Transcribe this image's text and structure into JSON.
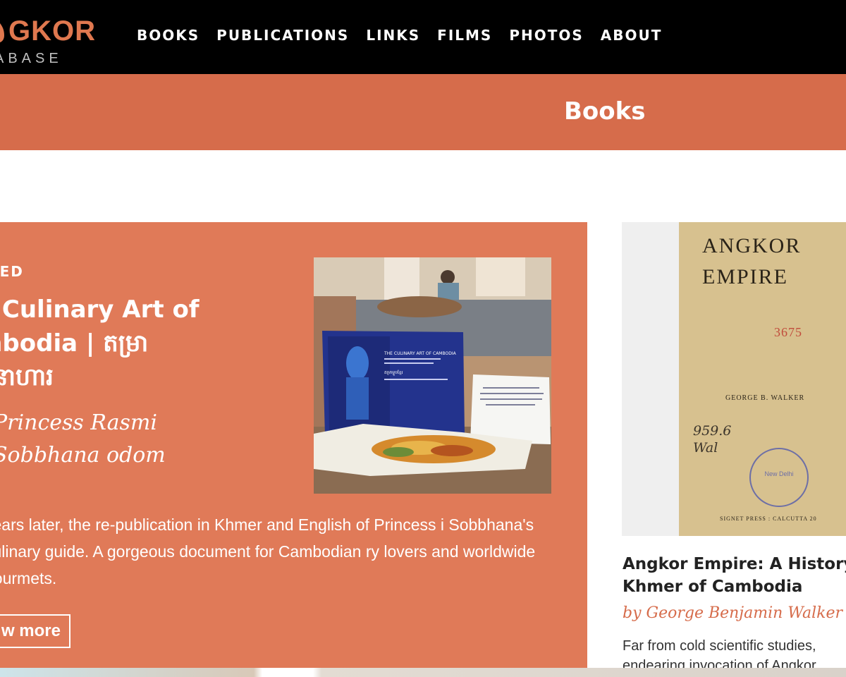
{
  "brand": {
    "logo_main": "GKOR",
    "logo_sub": "ABASE",
    "accent": "#d66c4b"
  },
  "nav": {
    "items": [
      "BOOKS",
      "PUBLICATIONS",
      "LINKS",
      "FILMS",
      "PHOTOS",
      "ABOUT"
    ]
  },
  "page": {
    "title": "Books"
  },
  "featured": {
    "kicker": "URED",
    "title": "e Culinary Art of mbodia | តម្រា ជនាហារ",
    "author": "Princess Rasmi Sobbhana odom",
    "description": "years later, the re-publication in Khmer and English of Princess i Sobbhana's culinary guide. A gorgeous document for Cambodian ry lovers and worldwide gourmets.",
    "button_label": "w more",
    "image": {
      "book_title": "THE CULINARY ART OF CAMBODIA",
      "book_khmer": "តម្រាម្ហូបខ្មែរ"
    }
  },
  "side_book": {
    "cover": {
      "title": "ANGKOR\nEMPIRE",
      "number": "3675",
      "author": "GEORGE B. WALKER",
      "shelfmark": "959.6\nWal",
      "stamp": "New Delhi",
      "publisher": "SIGNET PRESS : CALCUTTA 20"
    },
    "title_line1": "Angkor Empire: A History",
    "title_line2": "Khmer of Cambodia",
    "author": "by George Benjamin Walker",
    "description": "Far from cold scientific studies,\nendearing invocation of Angkor"
  }
}
